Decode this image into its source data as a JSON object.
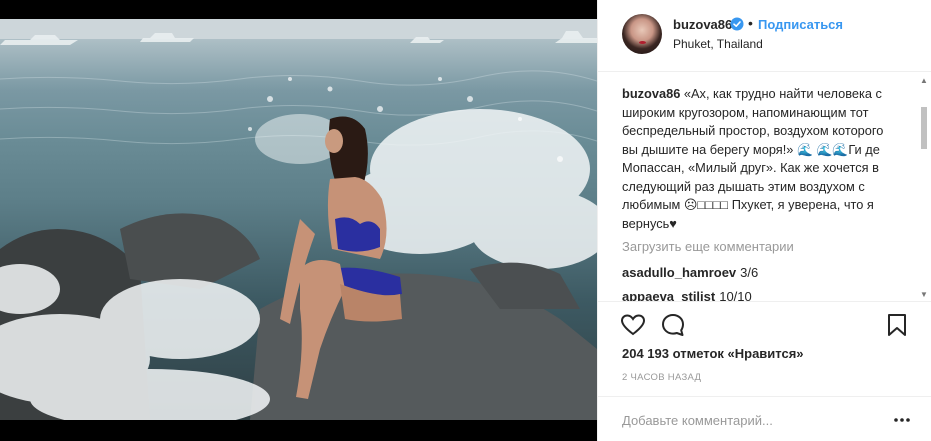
{
  "post": {
    "image_alt": "Woman in blue swimsuit sitting on rock with waves splashing",
    "author": {
      "username": "buzova86",
      "verified": true,
      "follow_label": "Подписаться",
      "location": "Phuket, Thailand"
    },
    "caption": {
      "username": "buzova86",
      "text": "«Ах, как трудно найти человека с широким кругозором, напоминающим тот беспредельный простор, воздухом которого вы дышите на берегу моря!» 🌊 🌊🌊Ги де Мопассан, «Милый друг». Как же хочется в следующий раз дышать этим воздухом с любимым ☹□□□□ Пхукет, я уверена, что я вернусь♥"
    },
    "load_more_label": "Загрузить еще комментарии",
    "comments": [
      {
        "username": "asadullo_hamroev",
        "text": "3/6"
      },
      {
        "username": "appaeva_stilist",
        "text": "10/10"
      }
    ],
    "likes_text": "204 193 отметок «Нравится»",
    "time_ago": "2 ЧАСОВ НАЗАД",
    "comment_placeholder": "Добавьте комментарий...",
    "icons": {
      "like": "heart-icon",
      "comment": "speech-bubble-icon",
      "save": "bookmark-icon",
      "more": "ellipsis-icon",
      "verified": "verified-badge-icon"
    },
    "colors": {
      "link_blue": "#3897f0",
      "muted_text": "#999999",
      "border": "#efefef",
      "verified_blue": "#3897f0"
    }
  }
}
